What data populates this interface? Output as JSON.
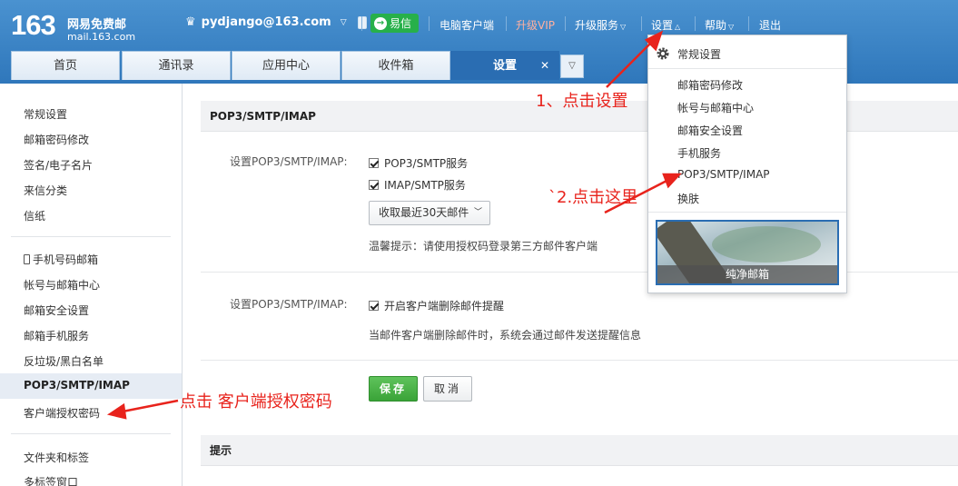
{
  "header": {
    "logo_number": "163",
    "logo_name": "网易免费邮",
    "logo_url": "mail.163.com",
    "user_email": "pydjango@163.com",
    "yixin_label": "易信",
    "links": [
      "电脑客户端",
      "升级VIP",
      "升级服务",
      "设置",
      "帮助",
      "退出"
    ]
  },
  "tabs": [
    "首页",
    "通讯录",
    "应用中心",
    "收件箱",
    "设置"
  ],
  "sidebar": {
    "group1": [
      "常规设置",
      "邮箱密码修改",
      "签名/电子名片",
      "来信分类",
      "信纸"
    ],
    "group2": [
      "手机号码邮箱",
      "帐号与邮箱中心",
      "邮箱安全设置",
      "邮箱手机服务",
      "反垃圾/黑白名单",
      "POP3/SMTP/IMAP",
      "客户端授权密码"
    ],
    "group3": [
      "文件夹和标签",
      "多标签窗口"
    ]
  },
  "main": {
    "section_title": "POP3/SMTP/IMAP",
    "row1_label": "设置POP3/SMTP/IMAP:",
    "pop3_label": "POP3/SMTP服务",
    "imap_label": "IMAP/SMTP服务",
    "select_value": "收取最近30天邮件",
    "tip": "温馨提示：请使用授权码登录第三方邮件客户端",
    "row2_label": "设置POP3/SMTP/IMAP:",
    "delete_notify_label": "开启客户端删除邮件提醒",
    "delete_notify_desc": "当邮件客户端删除邮件时，系统会通过邮件发送提醒信息",
    "save_label": "保存",
    "cancel_label": "取消",
    "section2_title": "提示"
  },
  "dropdown": {
    "header": "常规设置",
    "items": [
      "邮箱密码修改",
      "帐号与邮箱中心",
      "邮箱安全设置",
      "手机服务",
      "POP3/SMTP/IMAP",
      "换肤"
    ],
    "skin_caption": "纯净邮箱"
  },
  "annotations": {
    "step1": "1、点击设置",
    "step2": "`2.点击这里",
    "step3": "点击 客户端授权密码"
  },
  "colors": {
    "header_blue": "#2f77bb",
    "active_tab": "#2a6db2",
    "annotation_red": "#e8231c",
    "save_green": "#3aa338"
  }
}
